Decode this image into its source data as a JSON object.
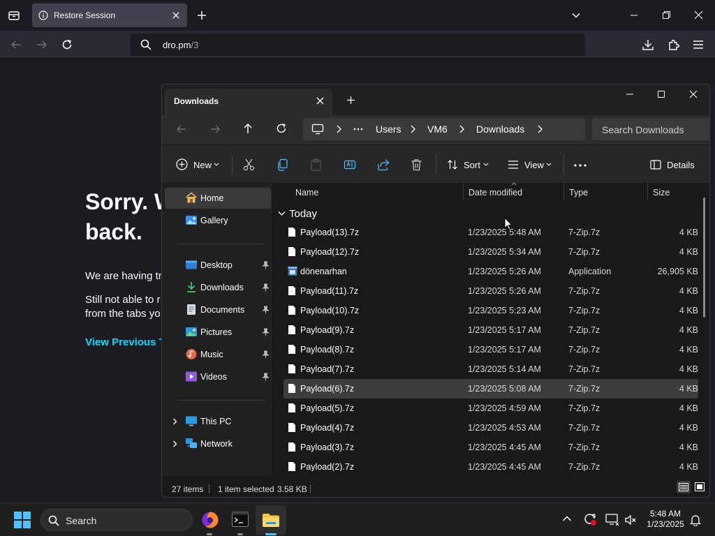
{
  "firefox": {
    "tab_title": "Restore Session",
    "url_host": "dro.pm",
    "url_path": "/3"
  },
  "error_page": {
    "title": "Sorry. W\nback.",
    "para1": "We are having tr",
    "para2": "Still not able to r\nfrom the tabs yo",
    "link": "View Previous Ta"
  },
  "explorer": {
    "tab_title": "Downloads",
    "breadcrumbs": [
      "Users",
      "VM6",
      "Downloads"
    ],
    "search_placeholder": "Search Downloads",
    "toolbar": {
      "new_label": "New",
      "sort_label": "Sort",
      "view_label": "View",
      "details_label": "Details"
    },
    "nav": {
      "home": "Home",
      "gallery": "Gallery",
      "desktop": "Desktop",
      "downloads": "Downloads",
      "documents": "Documents",
      "pictures": "Pictures",
      "music": "Music",
      "videos": "Videos",
      "this_pc": "This PC",
      "network": "Network"
    },
    "columns": {
      "name": "Name",
      "date": "Date modified",
      "type": "Type",
      "size": "Size"
    },
    "group": "Today",
    "files": [
      {
        "name": "Payload(13).7z",
        "date": "1/23/2025 5:48 AM",
        "type": "7-Zip.7z",
        "size": "4 KB",
        "icon": "file-icon"
      },
      {
        "name": "Payload(12).7z",
        "date": "1/23/2025 5:34 AM",
        "type": "7-Zip.7z",
        "size": "4 KB",
        "icon": "file-icon"
      },
      {
        "name": "dönenarhan",
        "date": "1/23/2025 5:26 AM",
        "type": "Application",
        "size": "26,905 KB",
        "icon": "application-icon"
      },
      {
        "name": "Payload(11).7z",
        "date": "1/23/2025 5:26 AM",
        "type": "7-Zip.7z",
        "size": "4 KB",
        "icon": "file-icon"
      },
      {
        "name": "Payload(10).7z",
        "date": "1/23/2025 5:23 AM",
        "type": "7-Zip.7z",
        "size": "4 KB",
        "icon": "file-icon"
      },
      {
        "name": "Payload(9).7z",
        "date": "1/23/2025 5:17 AM",
        "type": "7-Zip.7z",
        "size": "4 KB",
        "icon": "file-icon"
      },
      {
        "name": "Payload(8).7z",
        "date": "1/23/2025 5:17 AM",
        "type": "7-Zip.7z",
        "size": "4 KB",
        "icon": "file-icon"
      },
      {
        "name": "Payload(7).7z",
        "date": "1/23/2025 5:14 AM",
        "type": "7-Zip.7z",
        "size": "4 KB",
        "icon": "file-icon"
      },
      {
        "name": "Payload(6).7z",
        "date": "1/23/2025 5:08 AM",
        "type": "7-Zip.7z",
        "size": "4 KB",
        "icon": "file-icon",
        "selected": true
      },
      {
        "name": "Payload(5).7z",
        "date": "1/23/2025 4:59 AM",
        "type": "7-Zip.7z",
        "size": "4 KB",
        "icon": "file-icon"
      },
      {
        "name": "Payload(4).7z",
        "date": "1/23/2025 4:53 AM",
        "type": "7-Zip.7z",
        "size": "4 KB",
        "icon": "file-icon"
      },
      {
        "name": "Payload(3).7z",
        "date": "1/23/2025 4:45 AM",
        "type": "7-Zip.7z",
        "size": "4 KB",
        "icon": "file-icon"
      },
      {
        "name": "Payload(2).7z",
        "date": "1/23/2025 4:45 AM",
        "type": "7-Zip.7z",
        "size": "4 KB",
        "icon": "file-icon"
      }
    ],
    "status": {
      "items": "27 items",
      "selected": "1 item selected",
      "selected_size": "3.58 KB"
    }
  },
  "taskbar": {
    "search_label": "Search",
    "time": "5:48 AM",
    "date": "1/23/2025"
  },
  "colors": {
    "firefox_bg": "#1c1b22",
    "firefox_link": "#00ddff",
    "explorer_bg": "#191919",
    "selection": "#3d3d3d",
    "accent_blue": "#4cc2ff",
    "folder_yellow": "#f4c542"
  }
}
